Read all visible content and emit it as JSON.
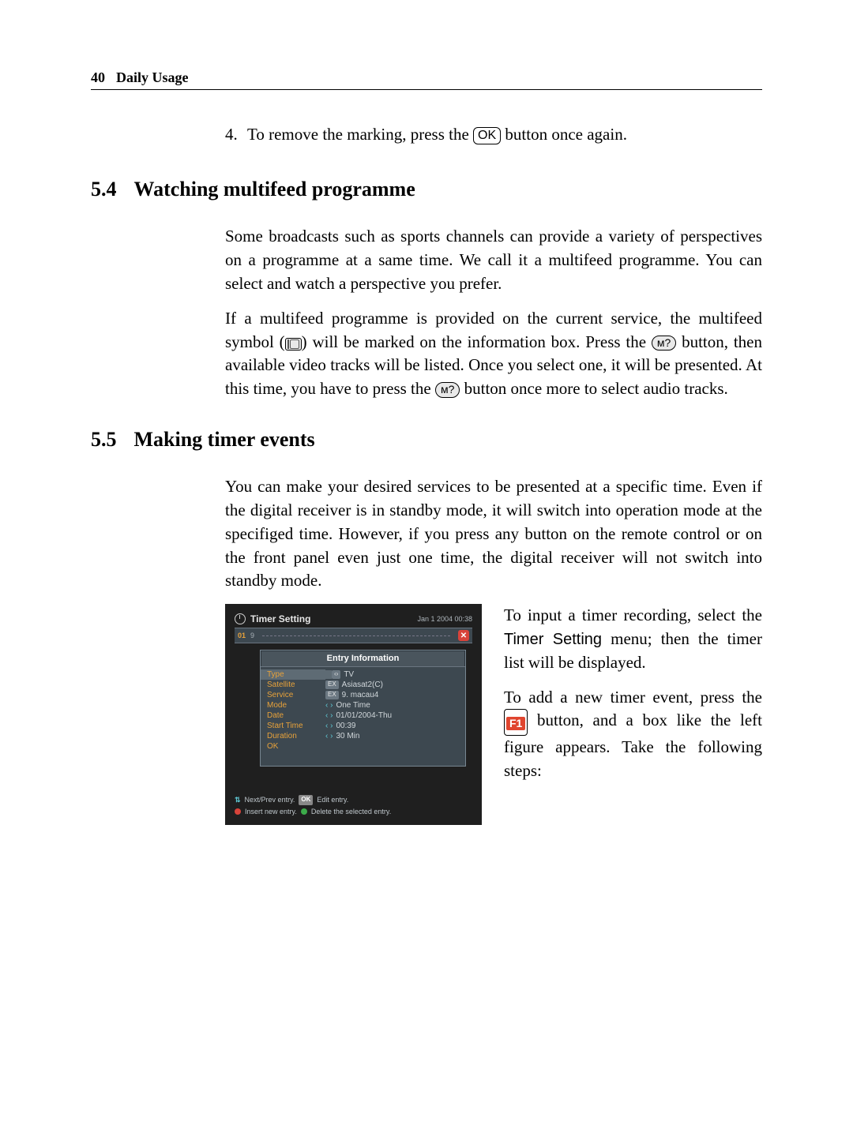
{
  "header": {
    "page_no": "40",
    "chapter": "Daily Usage"
  },
  "item4": {
    "num": "4.",
    "text_before": "To remove the marking, press the ",
    "ok": "OK",
    "text_after": " button once again."
  },
  "sect54": {
    "num": "5.4",
    "title": "Watching multifeed programme",
    "p1": "Some broadcasts such as sports channels can provide a variety of perspectives on a programme at a same time. We call it a multifeed programme. You can select and watch a perspective you prefer.",
    "p2a": "If a multifeed programme is provided on the current service, the multifeed symbol (",
    "p2b": ") will be marked on the information box. Press the ",
    "p2c": " button, then available video tracks will be listed. Once you select one, it will be presented. At this time, you have to press the ",
    "p2d": " button once more to select audio tracks.",
    "audq": "ᴍ?"
  },
  "sect55": {
    "num": "5.5",
    "title": "Making timer events",
    "p1": "You can make your desired services to be presented at a specific time. Even if the digital receiver is in standby mode, it will switch into operation mode at the specifiged time. However, if you press any button on the remote control or on the front panel even just one time, the digital receiver will not switch into standby mode.",
    "p2a": "To input a timer recording, select the ",
    "menu": "Timer Setting",
    "p2b": " menu; then the timer list will be displayed.",
    "p3a": "To add a new timer event, press the ",
    "f1": "F1",
    "p3b": " button, and a box like the left figure appears. Take the following steps:"
  },
  "screenshot": {
    "title": "Timer Setting",
    "datetime": "Jan 1 2004 00:38",
    "row_idx": "01",
    "row_num": "9",
    "panel_title": "Entry Information",
    "rows": [
      {
        "label": "Type",
        "prefix_tag": "‹›",
        "value": "TV"
      },
      {
        "label": "Satellite",
        "prefix_tag": "EX",
        "value": "Asiasat2(C)"
      },
      {
        "label": "Service",
        "prefix_tag": "EX",
        "value": "9. macau4"
      },
      {
        "label": "Mode",
        "prefix_arr": "‹ ›",
        "value": "One Time"
      },
      {
        "label": "Date",
        "prefix_arr": "‹ ›",
        "value": "01/01/2004-Thu"
      },
      {
        "label": "Start Time",
        "prefix_arr": "‹ ›",
        "value": "00:39"
      },
      {
        "label": "Duration",
        "prefix_arr": "‹ ›",
        "value": "30 Min"
      },
      {
        "label": "OK",
        "value": ""
      }
    ],
    "legend1a": "Next/Prev entry.",
    "legend1b_key": "OK",
    "legend1b": "Edit entry.",
    "legend2a": "Insert new entry.",
    "legend2b": "Delete the selected entry."
  }
}
